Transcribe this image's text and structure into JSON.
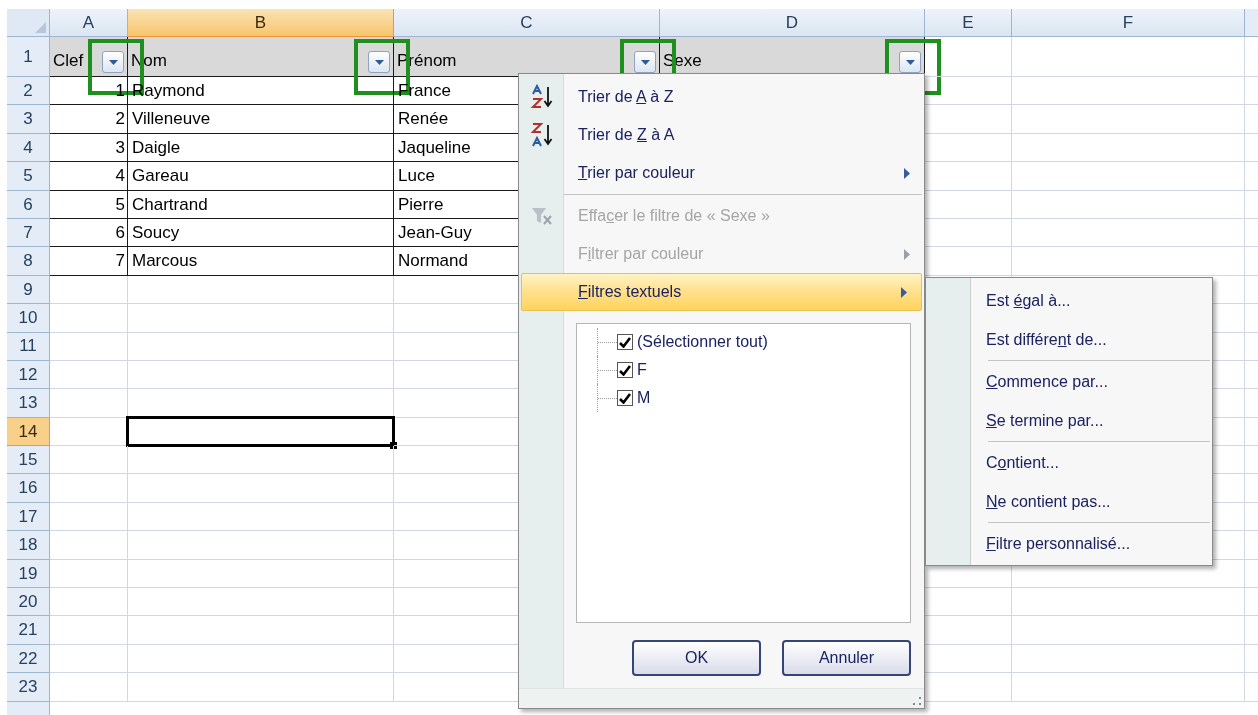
{
  "columns": [
    {
      "label": "A",
      "selected": false
    },
    {
      "label": "B",
      "selected": true
    },
    {
      "label": "C",
      "selected": false
    },
    {
      "label": "D",
      "selected": false
    },
    {
      "label": "E",
      "selected": false
    },
    {
      "label": "F",
      "selected": false
    }
  ],
  "rows": [
    {
      "label": "1",
      "selected": false,
      "header": [
        {
          "text": "Clef",
          "highlighted": true
        },
        {
          "text": "Nom",
          "highlighted": true
        },
        {
          "text": "Prénom",
          "highlighted": true
        },
        {
          "text": "Sexe",
          "highlighted": true
        }
      ]
    },
    {
      "label": "2",
      "selected": false,
      "cells": [
        "1",
        "Raymond",
        "France"
      ]
    },
    {
      "label": "3",
      "selected": false,
      "cells": [
        "2",
        "Villeneuve",
        "Renée"
      ]
    },
    {
      "label": "4",
      "selected": false,
      "cells": [
        "3",
        "Daigle",
        "Jaqueline"
      ]
    },
    {
      "label": "5",
      "selected": false,
      "cells": [
        "4",
        "Gareau",
        "Luce"
      ]
    },
    {
      "label": "6",
      "selected": false,
      "cells": [
        "5",
        "Chartrand",
        "Pierre"
      ]
    },
    {
      "label": "7",
      "selected": false,
      "cells": [
        "6",
        "Soucy",
        "Jean-Guy"
      ]
    },
    {
      "label": "8",
      "selected": false,
      "cells": [
        "7",
        "Marcous",
        "Normand"
      ]
    },
    {
      "label": "9",
      "selected": false
    },
    {
      "label": "10",
      "selected": false
    },
    {
      "label": "11",
      "selected": false
    },
    {
      "label": "12",
      "selected": false
    },
    {
      "label": "13",
      "selected": false
    },
    {
      "label": "14",
      "selected": true
    },
    {
      "label": "15",
      "selected": false
    },
    {
      "label": "16",
      "selected": false
    },
    {
      "label": "17",
      "selected": false
    },
    {
      "label": "18",
      "selected": false
    },
    {
      "label": "19",
      "selected": false
    },
    {
      "label": "20",
      "selected": false
    },
    {
      "label": "21",
      "selected": false
    },
    {
      "label": "22",
      "selected": false
    },
    {
      "label": "23",
      "selected": false
    }
  ],
  "menu": {
    "items": [
      {
        "kind": "sort-asc",
        "before": "Trier de ",
        "accel": "A",
        "after": " à Z",
        "disabled": false,
        "submenu": false,
        "selected": false
      },
      {
        "kind": "sort-desc",
        "before": "Trier de ",
        "accel": "Z",
        "after": " à A",
        "disabled": false,
        "submenu": false,
        "selected": false
      },
      {
        "kind": "plain",
        "accel": "T",
        "after": "rier par couleur",
        "disabled": false,
        "submenu": true,
        "selected": false
      },
      {
        "kind": "separator"
      },
      {
        "kind": "clear-filter",
        "before": "Effa",
        "accel": "c",
        "after": "er le filtre de « Sexe »",
        "disabled": true,
        "submenu": false,
        "selected": false
      },
      {
        "kind": "plain",
        "before": "F",
        "accel": "i",
        "after": "ltrer par couleur",
        "disabled": true,
        "submenu": true,
        "selected": false
      },
      {
        "kind": "plain",
        "accel": "F",
        "after": "iltres textuels",
        "disabled": false,
        "submenu": true,
        "selected": true
      }
    ],
    "values": [
      {
        "label": "(Sélectionner tout)",
        "checked": true
      },
      {
        "label": "F",
        "checked": true
      },
      {
        "label": "M",
        "checked": true
      }
    ],
    "buttons": [
      "OK",
      "Annuler"
    ]
  },
  "submenu": {
    "items": [
      {
        "kind": "item",
        "before": "Est ",
        "accel": "é",
        "after": "gal à..."
      },
      {
        "kind": "item",
        "before": "Est différe",
        "accel": "n",
        "after": "t de..."
      },
      {
        "kind": "separator"
      },
      {
        "kind": "item",
        "accel": "C",
        "after": "ommence par..."
      },
      {
        "kind": "item",
        "accel": "S",
        "after": "e termine par..."
      },
      {
        "kind": "separator"
      },
      {
        "kind": "item",
        "before": "C",
        "accel": "o",
        "after": "ntient..."
      },
      {
        "kind": "item",
        "accel": "N",
        "after": "e contient pas..."
      },
      {
        "kind": "separator"
      },
      {
        "kind": "item",
        "accel": "F",
        "after": "iltre personnalisé..."
      }
    ]
  }
}
